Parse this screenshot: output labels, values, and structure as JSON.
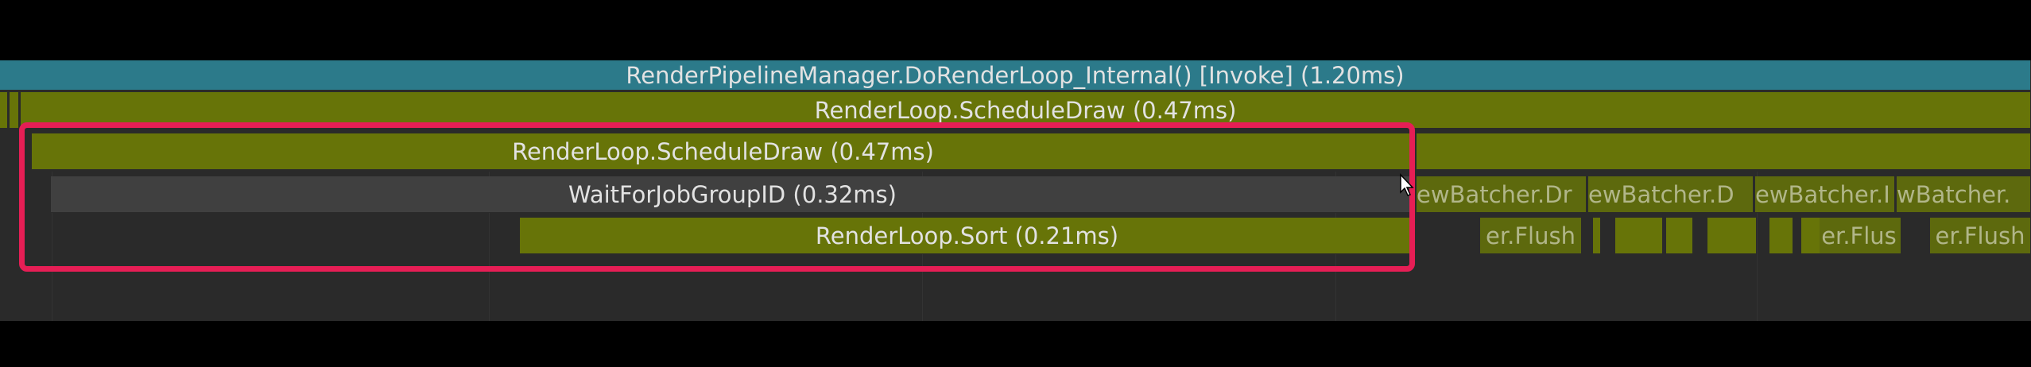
{
  "bars": {
    "row0": "RenderPipelineManager.DoRenderLoop_Internal() [Invoke] (1.20ms)",
    "row1": "RenderLoop.ScheduleDraw (0.47ms)",
    "row2": "RenderLoop.ScheduleDraw (0.47ms)",
    "row3": "WaitForJobGroupID (0.32ms)",
    "row4": "RenderLoop.Sort (0.21ms)"
  },
  "fragments": {
    "row3": [
      "ewBatcher.Dr",
      "ewBatcher.D",
      "ewBatcher.I",
      "wBatcher."
    ],
    "row4": [
      "er.Flush",
      "er.Flus",
      "er.Flush"
    ]
  },
  "colors": {
    "highlight": "#e61e55",
    "olive": "#677408",
    "teal": "#2c7a8a",
    "grey": "#404040"
  }
}
